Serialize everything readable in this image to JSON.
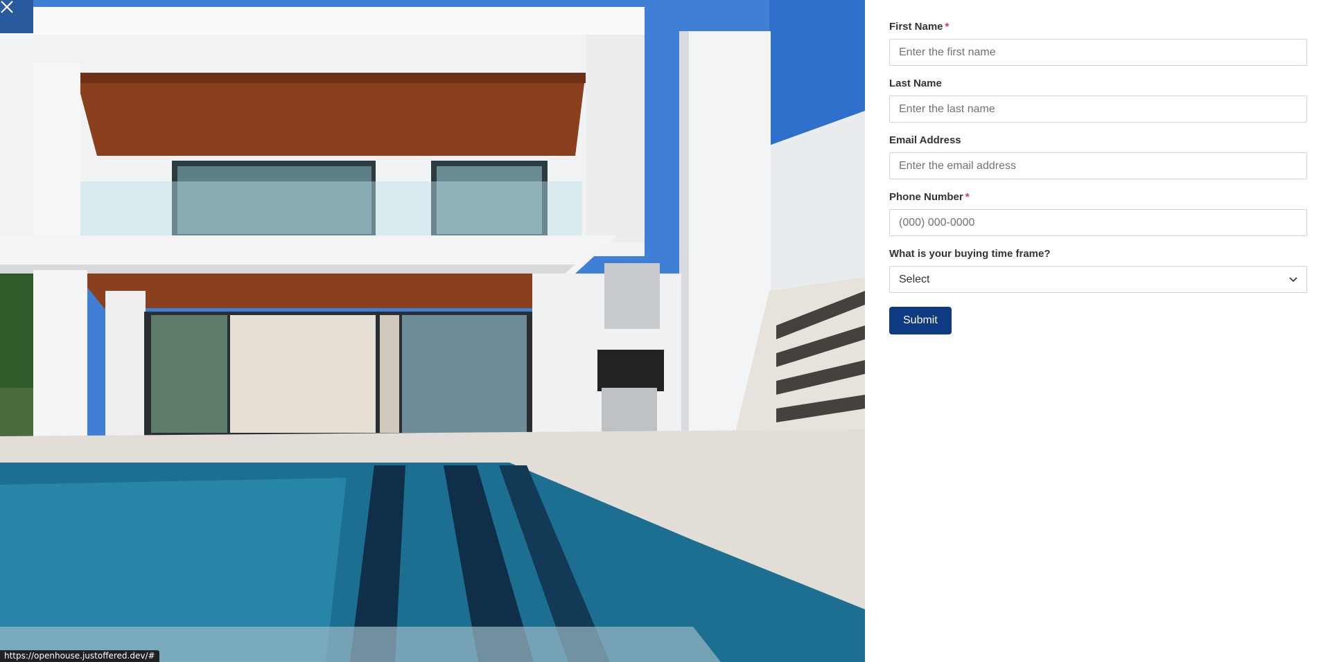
{
  "photo": {
    "description_icon": "house-photo",
    "close_icon": "close-icon"
  },
  "form": {
    "first_name": {
      "label": "First Name",
      "required_mark": "*",
      "placeholder": "Enter the first name"
    },
    "last_name": {
      "label": "Last Name",
      "placeholder": "Enter the last name"
    },
    "email": {
      "label": "Email Address",
      "placeholder": "Enter the email address"
    },
    "phone": {
      "label": "Phone Number",
      "required_mark": "*",
      "placeholder": "(000) 000-0000"
    },
    "timeframe": {
      "label": "What is your buying time frame?",
      "selected": "Select",
      "icon": "chevron-down-icon"
    },
    "submit_label": "Submit"
  },
  "status_bar": {
    "url": "https://openhouse.justoffered.dev/#"
  },
  "colors": {
    "accent": "#0d3a82",
    "required": "#dc3545",
    "close_bg": "#2a5a9e"
  }
}
